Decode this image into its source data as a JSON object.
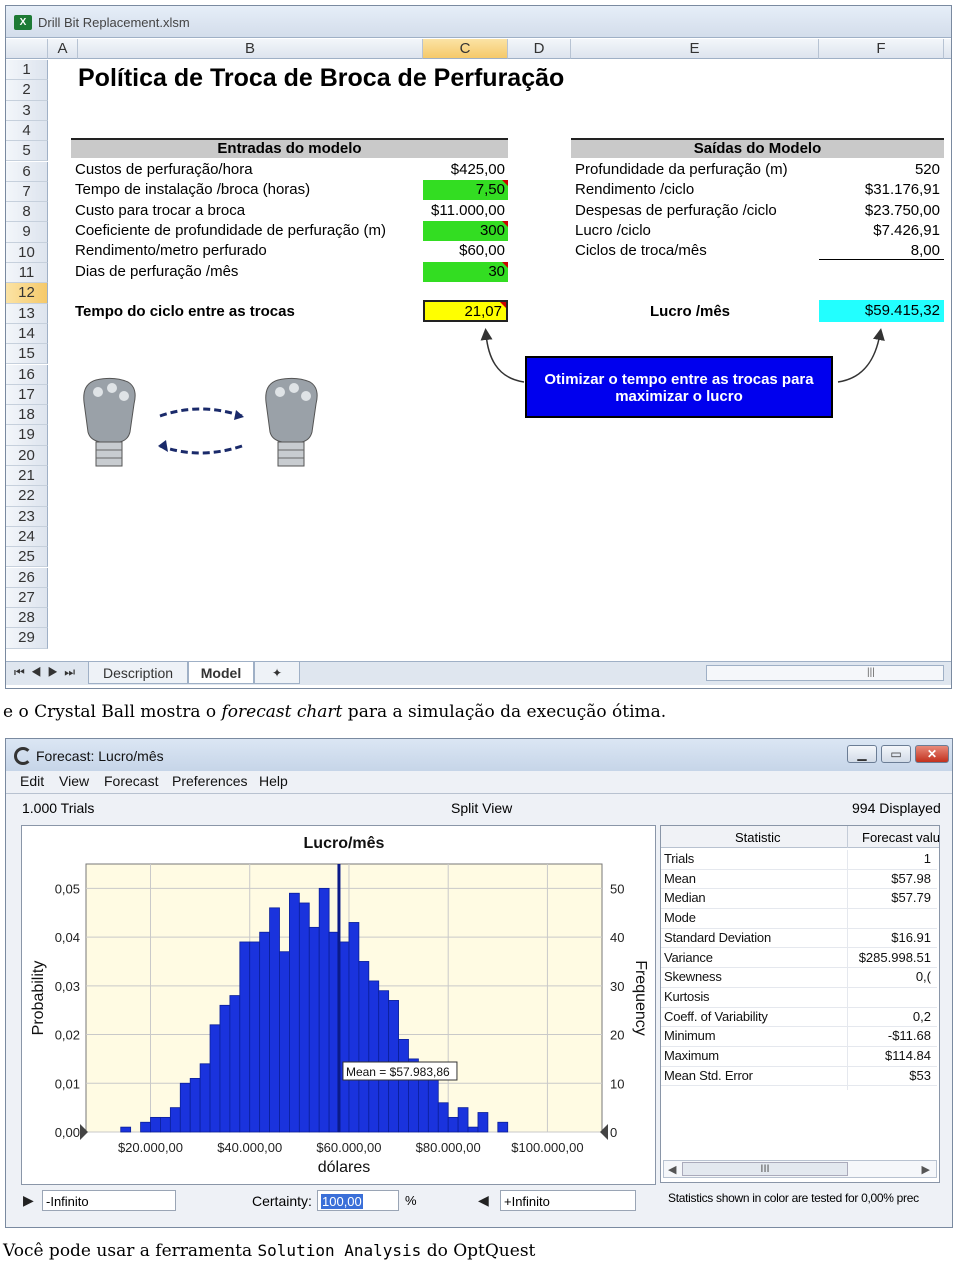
{
  "excel": {
    "file_title": "Drill Bit Replacement.xlsm",
    "icon_letter": "X",
    "columns": [
      "A",
      "B",
      "C",
      "D",
      "E",
      "F"
    ],
    "rows": [
      "1",
      "2",
      "3",
      "4",
      "5",
      "6",
      "7",
      "8",
      "9",
      "10",
      "11",
      "12",
      "13",
      "14",
      "15",
      "16",
      "17",
      "18",
      "19",
      "20",
      "21",
      "22",
      "23",
      "24",
      "25",
      "26",
      "27",
      "28",
      "29"
    ],
    "sheet_title": "Política de Troca de Broca de Perfuração",
    "inputs_header": "Entradas do modelo",
    "inputs": [
      {
        "label": "Custos de perfuração/hora",
        "value": "$425,00",
        "style": "plain"
      },
      {
        "label": "Tempo de instalação /broca (horas)",
        "value": "7,50",
        "style": "green"
      },
      {
        "label": "Custo para trocar a broca",
        "value": "$11.000,00",
        "style": "plain"
      },
      {
        "label": "Coeficiente de profundidade de perfuração (m)",
        "value": "300",
        "style": "green"
      },
      {
        "label": "Rendimento/metro perfurado",
        "value": "$60,00",
        "style": "plain"
      },
      {
        "label": "Dias de perfuração /mês",
        "value": "30",
        "style": "green"
      }
    ],
    "outputs_header": "Saídas do Modelo",
    "outputs": [
      {
        "label": "Profundidade da perfuração (m)",
        "value": "520"
      },
      {
        "label": "Rendimento /ciclo",
        "value": "$31.176,91"
      },
      {
        "label": "Despesas de perfuração /ciclo",
        "value": "$23.750,00"
      },
      {
        "label": "Lucro /ciclo",
        "value": "$7.426,91"
      },
      {
        "label": "Ciclos de troca/mês",
        "value": "8,00"
      }
    ],
    "cycle_label": "Tempo do ciclo entre as trocas",
    "cycle_value": "21,07",
    "profit_label": "Lucro /mês",
    "profit_value": "$59.415,32",
    "callout": "Otimizar o tempo entre as trocas para maximizar o lucro",
    "tabs": [
      "Description",
      "Model"
    ],
    "active_tab": "Model",
    "colors": {
      "green": "#33dd22",
      "yellow": "#ffff00",
      "cyan": "#22ffff",
      "callout": "#0000ee"
    }
  },
  "caption1": {
    "prefix": "e o Crystal Ball mostra o ",
    "italic": "forecast chart",
    "suffix": " para a simulação da execução ótima."
  },
  "forecast": {
    "window_title": "Forecast: Lucro/mês",
    "menu": [
      "Edit",
      "View",
      "Forecast",
      "Preferences",
      "Help"
    ],
    "trials_text": "1.000 Trials",
    "view_text": "Split View",
    "displayed_text": "994 Displayed",
    "certainty_label": "Certainty:",
    "certainty_value": "100,00",
    "percent": "%",
    "left_bound": "-Infinito",
    "right_bound": "+Infinito",
    "stats_header": [
      "Statistic",
      "Forecast valu"
    ],
    "stats": [
      {
        "k": "Trials",
        "v": "1"
      },
      {
        "k": "Mean",
        "v": "$57.98"
      },
      {
        "k": "Median",
        "v": "$57.79"
      },
      {
        "k": "Mode",
        "v": ""
      },
      {
        "k": "Standard Deviation",
        "v": "$16.91"
      },
      {
        "k": "Variance",
        "v": "$285.998.51"
      },
      {
        "k": "Skewness",
        "v": "0,("
      },
      {
        "k": "Kurtosis",
        "v": ""
      },
      {
        "k": "Coeff. of Variability",
        "v": "0,2"
      },
      {
        "k": "Minimum",
        "v": "-$11.68"
      },
      {
        "k": "Maximum",
        "v": "$114.84"
      },
      {
        "k": "Mean Std. Error",
        "v": "$53"
      }
    ],
    "stats_note": "Statistics shown in color are tested for 0,00% prec",
    "scroll_mark": "III"
  },
  "chart_data": {
    "type": "bar",
    "title": "Lucro/mês",
    "xlabel": "dólares",
    "ylabel_left": "Probability",
    "ylabel_right": "Frequency",
    "x_ticks": [
      "$20.000,00",
      "$40.000,00",
      "$60.000,00",
      "$80.000,00",
      "$100.000,00"
    ],
    "x_tick_values": [
      20000,
      40000,
      60000,
      80000,
      100000
    ],
    "y_left_ticks": [
      "0,00",
      "0,01",
      "0,02",
      "0,03",
      "0,04",
      "0,05"
    ],
    "y_right_ticks": [
      "0",
      "10",
      "20",
      "30",
      "40",
      "50"
    ],
    "ylim": [
      0,
      55
    ],
    "xlim": [
      7000,
      111000
    ],
    "bin_start": 10000,
    "bin_width": 2000,
    "frequencies": [
      0,
      0,
      1,
      0,
      2,
      3,
      3,
      5,
      10,
      11,
      14,
      22,
      26,
      28,
      39,
      39,
      41,
      46,
      37,
      49,
      47,
      42,
      50,
      41,
      39,
      43,
      35,
      31,
      29,
      27,
      19,
      15,
      12,
      11,
      6,
      3,
      5,
      1,
      4,
      0,
      2
    ],
    "mean_value": 57983.86,
    "mean_label": "Mean = $57.983,86",
    "bar_color": "#1a33dd",
    "plot_bg": "#fffbe3"
  },
  "caption2": {
    "prefix": "Você pode usar a ferramenta ",
    "mono": "Solution Analysis",
    "suffix": " do OptQuest"
  }
}
